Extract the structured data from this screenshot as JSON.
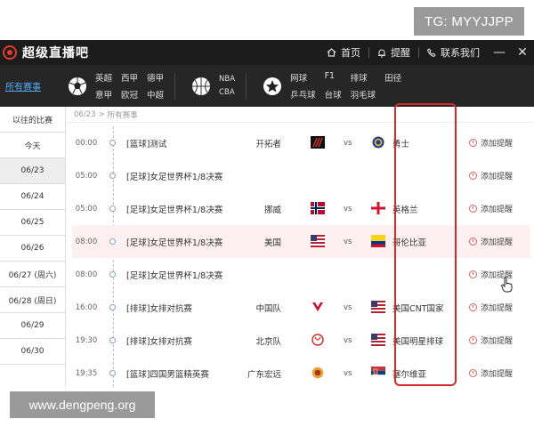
{
  "watermark_top": "TG: MYYJJPP",
  "watermark_bottom": "www.dengpeng.org",
  "app": {
    "title": "超级直播吧"
  },
  "titlebar": {
    "home": "首页",
    "remind": "提醒",
    "contact": "联系我们"
  },
  "categories": {
    "all_events": "所有赛事",
    "football": [
      "英超",
      "西甲",
      "德甲",
      "意甲",
      "欧冠",
      "中超"
    ],
    "basketball": [
      "NBA",
      "CBA"
    ],
    "others": [
      "网球",
      "F1",
      "排球",
      "田径",
      "乒乓球",
      "台球",
      "羽毛球"
    ]
  },
  "nav": [
    "以往的比赛",
    "今天",
    "06/23",
    "06/24",
    "06/25",
    "06/26",
    "06/27 (周六)",
    "06/28 (周日)",
    "06/29",
    "06/30"
  ],
  "breadcrumb": {
    "date": "06/23",
    "sep": ">",
    "section": "所有赛事"
  },
  "remind_label": "添加提醒",
  "vs_label": "vs",
  "rows": [
    {
      "time": "00:00",
      "event": "[篮球]测试",
      "home": "开拓者",
      "away": "勇士"
    },
    {
      "time": "05:00",
      "event": "[足球]女足世界杯1/8决赛",
      "home": "",
      "away": ""
    },
    {
      "time": "05:00",
      "event": "[足球]女足世界杯1/8决赛",
      "home": "挪威",
      "away": "英格兰"
    },
    {
      "time": "08:00",
      "event": "[足球]女足世界杯1/8决赛",
      "home": "美国",
      "away": "哥伦比亚"
    },
    {
      "time": "08:00",
      "event": "[足球]女足世界杯1/8决赛",
      "home": "",
      "away": ""
    },
    {
      "time": "16:00",
      "event": "[排球]女排对抗赛",
      "home": "中国队",
      "away": "美国CNT国家"
    },
    {
      "time": "19:30",
      "event": "[排球]女排对抗赛",
      "home": "北京队",
      "away": "美国明星排球"
    },
    {
      "time": "19:35",
      "event": "[篮球]四国男篮精英赛",
      "home": "广东宏远",
      "away": "塞尔维亚"
    }
  ],
  "colors": {
    "titlebar": "#1c1c1c",
    "catbar": "#262626",
    "accent_blue": "#52a8f0",
    "highlight_box": "#d42a2a"
  }
}
